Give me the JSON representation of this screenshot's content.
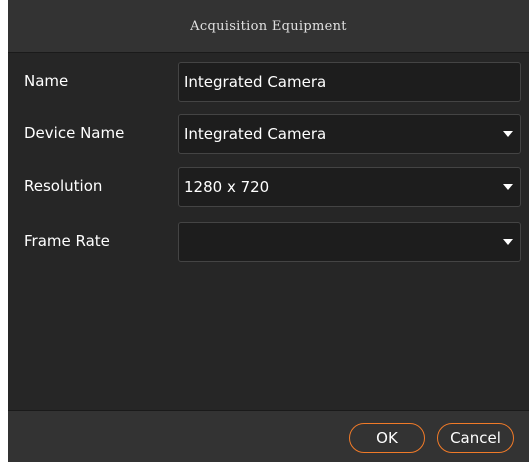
{
  "dialog": {
    "title": "Acquisition Equipment"
  },
  "form": {
    "name": {
      "label": "Name",
      "value": "Integrated Camera"
    },
    "device_name": {
      "label": "Device Name",
      "value": "Integrated Camera"
    },
    "resolution": {
      "label": "Resolution",
      "value": "1280 x 720"
    },
    "frame_rate": {
      "label": "Frame Rate",
      "value": ""
    }
  },
  "buttons": {
    "ok_label": "OK",
    "cancel_label": "Cancel"
  },
  "colors": {
    "background": "#262626",
    "titlebar": "#333333",
    "field_bg": "#1d1d1d",
    "accent": "#f07a28"
  }
}
